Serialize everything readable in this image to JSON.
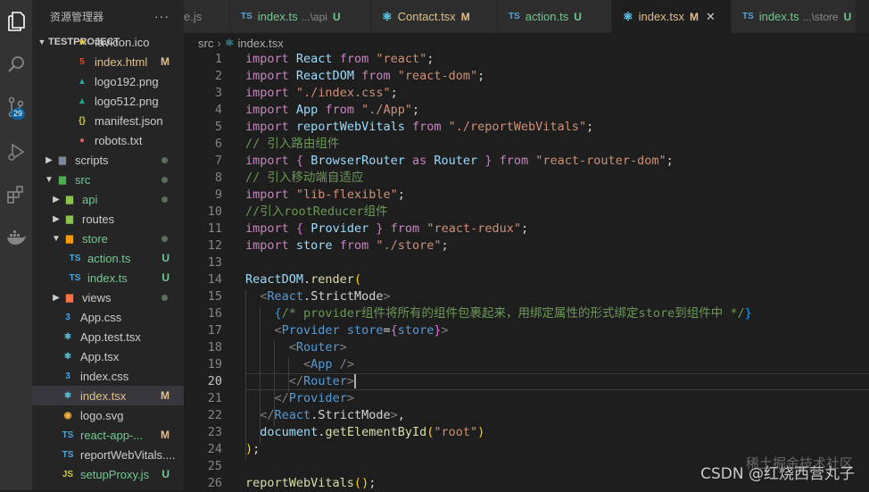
{
  "explorer": {
    "title": "资源管理器",
    "more": "···",
    "project": "TESTPROJECT",
    "items": [
      {
        "label": "favicon.ico",
        "icon": "star-icon",
        "status": ""
      },
      {
        "label": "index.html",
        "icon": "html-icon",
        "status": "M"
      },
      {
        "label": "logo192.png",
        "icon": "image-icon",
        "status": ""
      },
      {
        "label": "logo512.png",
        "icon": "image-icon",
        "status": ""
      },
      {
        "label": "manifest.json",
        "icon": "json-icon",
        "status": ""
      },
      {
        "label": "robots.txt",
        "icon": "robot-icon",
        "status": ""
      },
      {
        "label": "scripts",
        "icon": "folder-icon",
        "status": ""
      },
      {
        "label": "src",
        "icon": "folder-icon",
        "status": ""
      },
      {
        "label": "api",
        "icon": "folder-icon",
        "status": ""
      },
      {
        "label": "routes",
        "icon": "folder-icon",
        "status": ""
      },
      {
        "label": "store",
        "icon": "folder-icon",
        "status": ""
      },
      {
        "label": "action.ts",
        "icon": "typescript-icon",
        "status": "U"
      },
      {
        "label": "index.ts",
        "icon": "typescript-icon",
        "status": "U"
      },
      {
        "label": "views",
        "icon": "folder-icon",
        "status": ""
      },
      {
        "label": "App.css",
        "icon": "css-icon",
        "status": ""
      },
      {
        "label": "App.test.tsx",
        "icon": "react-icon",
        "status": ""
      },
      {
        "label": "App.tsx",
        "icon": "react-icon",
        "status": ""
      },
      {
        "label": "index.css",
        "icon": "css-icon",
        "status": ""
      },
      {
        "label": "index.tsx",
        "icon": "react-icon",
        "status": "M"
      },
      {
        "label": "logo.svg",
        "icon": "svg-icon",
        "status": ""
      },
      {
        "label": "react-app-...",
        "icon": "typescript-icon",
        "status": "M"
      },
      {
        "label": "reportWebVitals....",
        "icon": "typescript-icon",
        "status": ""
      },
      {
        "label": "setupProxy.js",
        "icon": "javascript-icon",
        "status": "U"
      }
    ]
  },
  "activity": {
    "scm_badge": "29"
  },
  "tabs": [
    {
      "label": "e.js",
      "dim": "",
      "mod": "",
      "icon": "javascript-icon"
    },
    {
      "label": "index.ts",
      "dim": "...\\api",
      "mod": "U",
      "icon": "typescript-icon"
    },
    {
      "label": "Contact.tsx",
      "dim": "",
      "mod": "M",
      "icon": "react-icon"
    },
    {
      "label": "action.ts",
      "dim": "",
      "mod": "U",
      "icon": "typescript-icon"
    },
    {
      "label": "index.tsx",
      "dim": "",
      "mod": "M",
      "icon": "react-icon"
    },
    {
      "label": "index.ts",
      "dim": "...\\store",
      "mod": "U",
      "icon": "typescript-icon"
    }
  ],
  "breadcrumb": {
    "folder": "src",
    "sep": "›",
    "file": "index.tsx"
  },
  "editor": {
    "current_line": "20",
    "lines": [
      "import React from \"react\";",
      "import ReactDOM from \"react-dom\";",
      "import \"./index.css\";",
      "import App from \"./App\";",
      "import reportWebVitals from \"./reportWebVitals\";",
      "// 引入路由组件",
      "import { BrowserRouter as Router } from \"react-router-dom\";",
      "// 引入移动端自适应",
      "import \"lib-flexible\";",
      "//引入rootReducer组件",
      "import { Provider } from \"react-redux\";",
      "import store from \"./store\";",
      "",
      "ReactDOM.render(",
      "  <React.StrictMode>",
      "    {/* provider组件将所有的组件包裹起来，用绑定属性的形式绑定store到组件中 */}",
      "    <Provider store={store}>",
      "      <Router>",
      "        <App />",
      "      </Router>",
      "    </Provider>",
      "  </React.StrictMode>,",
      "  document.getElementById(\"root\")",
      ");",
      "",
      "reportWebVitals();"
    ]
  },
  "watermark": "CSDN @红烧西营丸子",
  "watermark2": "稀土掘金技术社区"
}
